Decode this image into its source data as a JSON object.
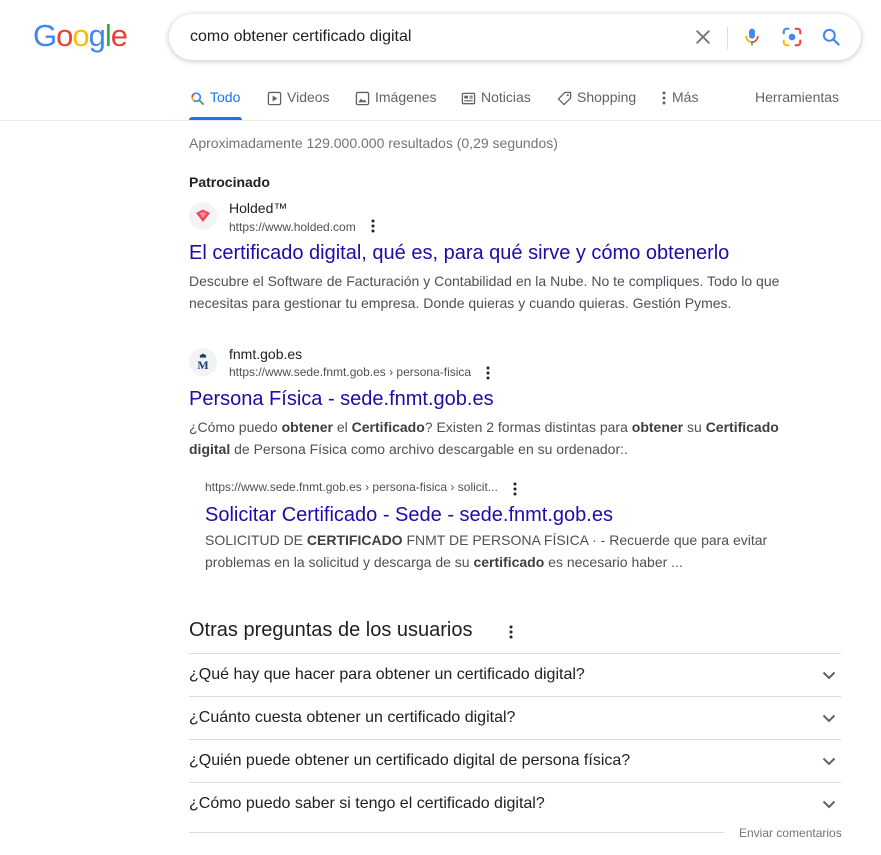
{
  "logo": {
    "letters": [
      "G",
      "o",
      "o",
      "g",
      "l",
      "e"
    ]
  },
  "search": {
    "query": "como obtener certificado digital"
  },
  "tabs": [
    {
      "label": "Todo",
      "icon": "search-icon",
      "active": true
    },
    {
      "label": "Videos",
      "icon": "play-icon",
      "active": false
    },
    {
      "label": "Imágenes",
      "icon": "image-icon",
      "active": false
    },
    {
      "label": "Noticias",
      "icon": "news-icon",
      "active": false
    },
    {
      "label": "Shopping",
      "icon": "tag-icon",
      "active": false
    },
    {
      "label": "Más",
      "icon": "more-vert-icon",
      "active": false
    }
  ],
  "tools_label": "Herramientas",
  "result_stats": "Aproximadamente 129.000.000 resultados (0,29 segundos)",
  "ad": {
    "sponsored_label": "Patrocinado",
    "site_name": "Holded™",
    "url": "https://www.holded.com",
    "title": "El certificado digital, qué es, para qué sirve y cómo obtenerlo",
    "snippet_line1": "Descubre el Software de Facturación y Contabilidad en la Nube. No te compliques. Todo lo que",
    "snippet_line2": "necesitas para gestionar tu empresa. Donde quieras y cuando quieras. Gestión Pymes."
  },
  "result1": {
    "site_name": "fnmt.gob.es",
    "url": "https://www.sede.fnmt.gob.es › persona-fisica",
    "title": "Persona Física - sede.fnmt.gob.es",
    "snippet": [
      {
        "t": "¿Cómo puedo ",
        "b": false
      },
      {
        "t": "obtener",
        "b": true
      },
      {
        "t": " el ",
        "b": false
      },
      {
        "t": "Certificado",
        "b": true
      },
      {
        "t": "? Existen 2 formas distintas para ",
        "b": false
      },
      {
        "t": "obtener",
        "b": true
      },
      {
        "t": " su ",
        "b": false
      },
      {
        "t": "Certificado",
        "b": true
      },
      {
        "t": " ",
        "b": false
      },
      {
        "t": "digital",
        "b": true
      },
      {
        "t": " de Persona Física como archivo descargable en su ordenador:.",
        "b": false
      }
    ]
  },
  "sublink": {
    "url": "https://www.sede.fnmt.gob.es › persona-fisica › solicit...",
    "title": "Solicitar Certificado - Sede - sede.fnmt.gob.es",
    "snippet": [
      {
        "t": "SOLICITUD DE ",
        "b": false
      },
      {
        "t": "CERTIFICADO",
        "b": true
      },
      {
        "t": " FNMT DE PERSONA FÍSICA · - Recuerde que para evitar problemas en la solicitud y descarga de su ",
        "b": false
      },
      {
        "t": "certificado",
        "b": true
      },
      {
        "t": " es necesario haber ...",
        "b": false
      }
    ]
  },
  "paa": {
    "title": "Otras preguntas de los usuarios",
    "questions": [
      "¿Qué hay que hacer para obtener un certificado digital?",
      "¿Cuánto cuesta obtener un certificado digital?",
      "¿Quién puede obtener un certificado digital de persona física?",
      "¿Cómo puedo saber si tengo el certificado digital?"
    ]
  },
  "feedback_label": "Enviar comentarios",
  "colors": {
    "link": "#1a0dab",
    "accent": "#1a73e8",
    "text": "#202124",
    "muted": "#70757a"
  }
}
